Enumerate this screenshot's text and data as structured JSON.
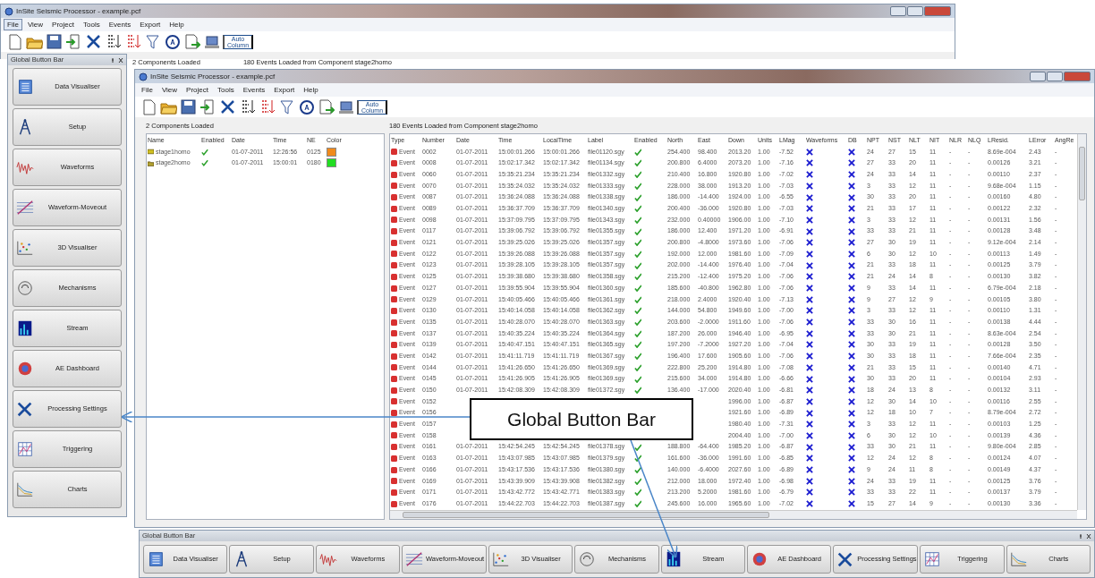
{
  "outer_window": {
    "title": "InSite Seismic Processor - example.pcf",
    "menu": [
      {
        "label": "File",
        "selected": true
      },
      {
        "label": "View",
        "selected": false
      },
      {
        "label": "Project",
        "selected": false
      },
      {
        "label": "Tools",
        "selected": false
      },
      {
        "label": "Events",
        "selected": false
      },
      {
        "label": "Export",
        "selected": false
      },
      {
        "label": "Help",
        "selected": false
      }
    ],
    "toolbar_label": "Auto Column",
    "status": [
      "2 Components Loaded",
      "180 Events Loaded from Component stage2homo"
    ]
  },
  "sidebar": {
    "title": "Global Button Bar",
    "buttons": [
      "Data Visualiser",
      "Setup",
      "Waveforms",
      "Waveform-Moveout",
      "3D Visualiser",
      "Mechanisms",
      "Stream",
      "AE Dashboard",
      "Processing Settings",
      "Triggering",
      "Charts"
    ]
  },
  "inner_window": {
    "title": "InSite Seismic Processor - example.pcf",
    "menu": [
      {
        "label": "File",
        "selected": false
      },
      {
        "label": "View",
        "selected": false
      },
      {
        "label": "Project",
        "selected": false
      },
      {
        "label": "Tools",
        "selected": false
      },
      {
        "label": "Events",
        "selected": false
      },
      {
        "label": "Export",
        "selected": false
      },
      {
        "label": "Help",
        "selected": false
      }
    ],
    "toolbar_label": "Auto Column",
    "components_title": "2 Components Loaded",
    "events_title": "180 Events Loaded from Component stage2homo",
    "components": {
      "columns": [
        "Name",
        "Enabled",
        "Date",
        "Time",
        "NE",
        "Color"
      ],
      "rows": [
        {
          "name": "stage1homo",
          "enabled": true,
          "date": "01-07-2011",
          "time": "12:26:56",
          "ne": "0125",
          "color": "#f08a1c"
        },
        {
          "name": "stage2homo",
          "enabled": true,
          "date": "01-07-2011",
          "time": "15:00:01",
          "ne": "0180",
          "color": "#22dd22"
        }
      ]
    },
    "events": {
      "columns": [
        {
          "label": "Type",
          "kind": "type"
        },
        {
          "label": "Number",
          "kind": "text"
        },
        {
          "label": "Date",
          "kind": "text"
        },
        {
          "label": "Time",
          "kind": "text"
        },
        {
          "label": "LocalTime",
          "kind": "text"
        },
        {
          "label": "Label",
          "kind": "text"
        },
        {
          "label": "Enabled",
          "kind": "check"
        },
        {
          "label": "North",
          "kind": "text"
        },
        {
          "label": "East",
          "kind": "text"
        },
        {
          "label": "Down",
          "kind": "text"
        },
        {
          "label": "Units",
          "kind": "text"
        },
        {
          "label": "LMag",
          "kind": "text"
        },
        {
          "label": "Waveforms",
          "kind": "check"
        },
        {
          "label": "DB",
          "kind": "check"
        },
        {
          "label": "NPT",
          "kind": "text"
        },
        {
          "label": "NST",
          "kind": "text"
        },
        {
          "label": "NLT",
          "kind": "text"
        },
        {
          "label": "NIT",
          "kind": "text"
        },
        {
          "label": "NLR",
          "kind": "text"
        },
        {
          "label": "NLQ",
          "kind": "text"
        },
        {
          "label": "LResid.",
          "kind": "text"
        },
        {
          "label": "LError",
          "kind": "text"
        },
        {
          "label": "AngRe",
          "kind": "text"
        }
      ],
      "rows": [
        {
          "cells": [
            "Event",
            "0002",
            "01-07-2011",
            "15:00:01.266",
            "15:00:01.266",
            "file01120.sgy",
            true,
            "254.400",
            "98.400",
            "2013.20",
            "1.00",
            "-7.52",
            false,
            false,
            "24",
            "27",
            "15",
            "11",
            "-",
            "-",
            "8.69e-004",
            "2.43",
            "-"
          ]
        },
        {
          "cells": [
            "Event",
            "0008",
            "01-07-2011",
            "15:02:17.342",
            "15:02:17.342",
            "file01134.sgy",
            true,
            "200.800",
            "6.4000",
            "2073.20",
            "1.00",
            "-7.16",
            false,
            false,
            "27",
            "33",
            "20",
            "11",
            "-",
            "-",
            "0.00126",
            "3.21",
            "-"
          ]
        },
        {
          "cells": [
            "Event",
            "0060",
            "01-07-2011",
            "15:35:21.234",
            "15:35:21.234",
            "file01332.sgy",
            true,
            "210.400",
            "16.800",
            "1920.80",
            "1.00",
            "-7.02",
            false,
            false,
            "24",
            "33",
            "14",
            "11",
            "-",
            "-",
            "0.00110",
            "2.37",
            "-"
          ]
        },
        {
          "cells": [
            "Event",
            "0070",
            "01-07-2011",
            "15:35:24.032",
            "15:35:24.032",
            "file01333.sgy",
            true,
            "228.000",
            "38.000",
            "1913.20",
            "1.00",
            "-7.03",
            false,
            false,
            "3",
            "33",
            "12",
            "11",
            "-",
            "-",
            "9.68e-004",
            "1.15",
            "-"
          ]
        },
        {
          "cells": [
            "Event",
            "0087",
            "01-07-2011",
            "15:36:24.088",
            "15:36:24.088",
            "file01338.sgy",
            true,
            "186.000",
            "-14.400",
            "1924.00",
            "1.00",
            "-6.55",
            false,
            false,
            "30",
            "33",
            "20",
            "11",
            "-",
            "-",
            "0.00160",
            "4.80",
            "-"
          ]
        },
        {
          "cells": [
            "Event",
            "0089",
            "01-07-2011",
            "15:36:37.709",
            "15:36:37.709",
            "file01340.sgy",
            true,
            "200.400",
            "-36.000",
            "1920.80",
            "1.00",
            "-7.03",
            false,
            false,
            "21",
            "33",
            "17",
            "11",
            "-",
            "-",
            "0.00122",
            "2.32",
            "-"
          ]
        },
        {
          "cells": [
            "Event",
            "0098",
            "01-07-2011",
            "15:37:09.795",
            "15:37:09.795",
            "file01343.sgy",
            true,
            "232.000",
            "0.40000",
            "1906.00",
            "1.00",
            "-7.10",
            false,
            false,
            "3",
            "33",
            "12",
            "11",
            "-",
            "-",
            "0.00131",
            "1.56",
            "-"
          ]
        },
        {
          "cells": [
            "Event",
            "0117",
            "01-07-2011",
            "15:39:06.792",
            "15:39:06.792",
            "file01355.sgy",
            true,
            "186.000",
            "12.400",
            "1971.20",
            "1.00",
            "-6.91",
            false,
            false,
            "33",
            "33",
            "21",
            "11",
            "-",
            "-",
            "0.00128",
            "3.48",
            "-"
          ]
        },
        {
          "cells": [
            "Event",
            "0121",
            "01-07-2011",
            "15:39:25.026",
            "15:39:25.026",
            "file01357.sgy",
            true,
            "200.800",
            "-4.8000",
            "1973.60",
            "1.00",
            "-7.06",
            false,
            false,
            "27",
            "30",
            "19",
            "11",
            "-",
            "-",
            "9.12e-004",
            "2.14",
            "-"
          ]
        },
        {
          "cells": [
            "Event",
            "0122",
            "01-07-2011",
            "15:39:26.088",
            "15:39:26.088",
            "file01357.sgy",
            true,
            "192.000",
            "12.000",
            "1981.60",
            "1.00",
            "-7.09",
            false,
            false,
            "6",
            "30",
            "12",
            "10",
            "-",
            "-",
            "0.00113",
            "1.49",
            "-"
          ]
        },
        {
          "cells": [
            "Event",
            "0123",
            "01-07-2011",
            "15:39:28.105",
            "15:39:28.105",
            "file01357.sgy",
            true,
            "202.000",
            "-14.400",
            "1976.40",
            "1.00",
            "-7.04",
            false,
            false,
            "21",
            "33",
            "18",
            "11",
            "-",
            "-",
            "0.00125",
            "3.79",
            "-"
          ]
        },
        {
          "cells": [
            "Event",
            "0125",
            "01-07-2011",
            "15:39:38.680",
            "15:39:38.680",
            "file01358.sgy",
            true,
            "215.200",
            "-12.400",
            "1975.20",
            "1.00",
            "-7.06",
            false,
            false,
            "21",
            "24",
            "14",
            "8",
            "-",
            "-",
            "0.00130",
            "3.82",
            "-"
          ]
        },
        {
          "cells": [
            "Event",
            "0127",
            "01-07-2011",
            "15:39:55.904",
            "15:39:55.904",
            "file01360.sgy",
            true,
            "185.600",
            "-40.800",
            "1962.80",
            "1.00",
            "-7.06",
            false,
            false,
            "9",
            "33",
            "14",
            "11",
            "-",
            "-",
            "6.79e-004",
            "2.18",
            "-"
          ]
        },
        {
          "cells": [
            "Event",
            "0129",
            "01-07-2011",
            "15:40:05.466",
            "15:40:05.466",
            "file01361.sgy",
            true,
            "218.000",
            "2.4000",
            "1920.40",
            "1.00",
            "-7.13",
            false,
            false,
            "9",
            "27",
            "12",
            "9",
            "-",
            "-",
            "0.00105",
            "3.80",
            "-"
          ]
        },
        {
          "cells": [
            "Event",
            "0130",
            "01-07-2011",
            "15:40:14.058",
            "15:40:14.058",
            "file01362.sgy",
            true,
            "144.000",
            "54.800",
            "1949.60",
            "1.00",
            "-7.00",
            false,
            false,
            "3",
            "33",
            "12",
            "11",
            "-",
            "-",
            "0.00110",
            "1.31",
            "-"
          ]
        },
        {
          "cells": [
            "Event",
            "0135",
            "01-07-2011",
            "15:40:28.070",
            "15:40:28.070",
            "file01363.sgy",
            true,
            "203.600",
            "-2.0000",
            "1911.60",
            "1.00",
            "-7.06",
            false,
            false,
            "33",
            "30",
            "16",
            "11",
            "-",
            "-",
            "0.00138",
            "4.44",
            "-"
          ]
        },
        {
          "cells": [
            "Event",
            "0137",
            "01-07-2011",
            "15:40:35.224",
            "15:40:35.224",
            "file01364.sgy",
            true,
            "187.200",
            "26.000",
            "1946.40",
            "1.00",
            "-6.95",
            false,
            false,
            "33",
            "30",
            "21",
            "11",
            "-",
            "-",
            "8.63e-004",
            "2.54",
            "-"
          ]
        },
        {
          "cells": [
            "Event",
            "0139",
            "01-07-2011",
            "15:40:47.151",
            "15:40:47.151",
            "file01365.sgy",
            true,
            "197.200",
            "-7.2000",
            "1927.20",
            "1.00",
            "-7.04",
            false,
            false,
            "30",
            "33",
            "19",
            "11",
            "-",
            "-",
            "0.00128",
            "3.50",
            "-"
          ]
        },
        {
          "cells": [
            "Event",
            "0142",
            "01-07-2011",
            "15:41:11.719",
            "15:41:11.719",
            "file01367.sgy",
            true,
            "196.400",
            "17.600",
            "1905.60",
            "1.00",
            "-7.06",
            false,
            false,
            "30",
            "33",
            "18",
            "11",
            "-",
            "-",
            "7.66e-004",
            "2.35",
            "-"
          ]
        },
        {
          "cells": [
            "Event",
            "0144",
            "01-07-2011",
            "15:41:26.650",
            "15:41:26.650",
            "file01369.sgy",
            true,
            "222.800",
            "25.200",
            "1914.80",
            "1.00",
            "-7.08",
            false,
            false,
            "21",
            "33",
            "15",
            "11",
            "-",
            "-",
            "0.00140",
            "4.71",
            "-"
          ]
        },
        {
          "cells": [
            "Event",
            "0145",
            "01-07-2011",
            "15:41:26.905",
            "15:41:26.905",
            "file01369.sgy",
            true,
            "215.600",
            "34.000",
            "1914.80",
            "1.00",
            "-6.66",
            false,
            false,
            "30",
            "33",
            "20",
            "11",
            "-",
            "-",
            "0.00104",
            "2.93",
            "-"
          ]
        },
        {
          "cells": [
            "Event",
            "0150",
            "01-07-2011",
            "15:42:08.309",
            "15:42:08.309",
            "file01372.sgy",
            true,
            "136.400",
            "-17.000",
            "2020.40",
            "1.00",
            "-6.81",
            false,
            false,
            "18",
            "24",
            "13",
            "8",
            "-",
            "-",
            "0.00132",
            "3.11",
            "-"
          ]
        },
        {
          "cells": [
            "Event",
            "0152",
            null,
            null,
            null,
            null,
            null,
            null,
            null,
            "1996.00",
            "1.00",
            "-6.87",
            false,
            false,
            "12",
            "30",
            "14",
            "10",
            "-",
            "-",
            "0.00116",
            "2.55",
            "-"
          ]
        },
        {
          "cells": [
            "Event",
            "0156",
            null,
            null,
            null,
            null,
            null,
            null,
            null,
            "1921.60",
            "1.00",
            "-6.89",
            false,
            false,
            "12",
            "18",
            "10",
            "7",
            "-",
            "-",
            "8.79e-004",
            "2.72",
            "-"
          ]
        },
        {
          "cells": [
            "Event",
            "0157",
            null,
            null,
            null,
            null,
            null,
            null,
            null,
            "1980.40",
            "1.00",
            "-7.31",
            false,
            false,
            "3",
            "33",
            "12",
            "11",
            "-",
            "-",
            "0.00103",
            "1.25",
            "-"
          ]
        },
        {
          "cells": [
            "Event",
            "0158",
            null,
            null,
            null,
            null,
            null,
            null,
            null,
            "2004.40",
            "1.00",
            "-7.00",
            false,
            false,
            "6",
            "30",
            "12",
            "10",
            "-",
            "-",
            "0.00139",
            "4.36",
            "-"
          ]
        },
        {
          "cells": [
            "Event",
            "0161",
            "01-07-2011",
            "15:42:54.245",
            "15:42:54.245",
            "file01378.sgy",
            true,
            "188.800",
            "-64.400",
            "1985.20",
            "1.00",
            "-6.87",
            false,
            false,
            "33",
            "30",
            "21",
            "11",
            "-",
            "-",
            "9.80e-004",
            "2.85",
            "-"
          ]
        },
        {
          "cells": [
            "Event",
            "0163",
            "01-07-2011",
            "15:43:07.985",
            "15:43:07.985",
            "file01379.sgy",
            true,
            "161.600",
            "-36.000",
            "1991.60",
            "1.00",
            "-6.85",
            false,
            false,
            "12",
            "24",
            "12",
            "8",
            "-",
            "-",
            "0.00124",
            "4.07",
            "-"
          ]
        },
        {
          "cells": [
            "Event",
            "0166",
            "01-07-2011",
            "15:43:17.536",
            "15:43:17.536",
            "file01380.sgy",
            true,
            "140.000",
            "-6.4000",
            "2027.60",
            "1.00",
            "-6.89",
            false,
            false,
            "9",
            "24",
            "11",
            "8",
            "-",
            "-",
            "0.00149",
            "4.37",
            "-"
          ]
        },
        {
          "cells": [
            "Event",
            "0169",
            "01-07-2011",
            "15:43:39.909",
            "15:43:39.908",
            "file01382.sgy",
            true,
            "212.000",
            "18.000",
            "1972.40",
            "1.00",
            "-6.98",
            false,
            false,
            "24",
            "33",
            "19",
            "11",
            "-",
            "-",
            "0.00125",
            "3.76",
            "-"
          ]
        },
        {
          "cells": [
            "Event",
            "0171",
            "01-07-2011",
            "15:43:42.772",
            "15:43:42.771",
            "file01383.sgy",
            true,
            "213.200",
            "5.2000",
            "1981.60",
            "1.00",
            "-6.79",
            false,
            false,
            "33",
            "33",
            "22",
            "11",
            "-",
            "-",
            "0.00137",
            "3.79",
            "-"
          ]
        },
        {
          "cells": [
            "Event",
            "0176",
            "01-07-2011",
            "15:44:22.703",
            "15:44:22.703",
            "file01387.sgy",
            true,
            "245.600",
            "16.000",
            "1965.60",
            "1.00",
            "-7.02",
            false,
            false,
            "15",
            "27",
            "14",
            "9",
            "-",
            "-",
            "0.00130",
            "3.36",
            "-"
          ]
        }
      ]
    }
  },
  "bottom_bar": {
    "title": "Global Button Bar",
    "buttons": [
      "Data Visualiser",
      "Setup",
      "Waveforms",
      "Waveform-Moveout",
      "3D Visualiser",
      "Mechanisms",
      "Stream",
      "AE Dashboard",
      "Processing Settings",
      "Triggering",
      "Charts"
    ]
  },
  "callout": {
    "text": "Global Button Bar"
  }
}
